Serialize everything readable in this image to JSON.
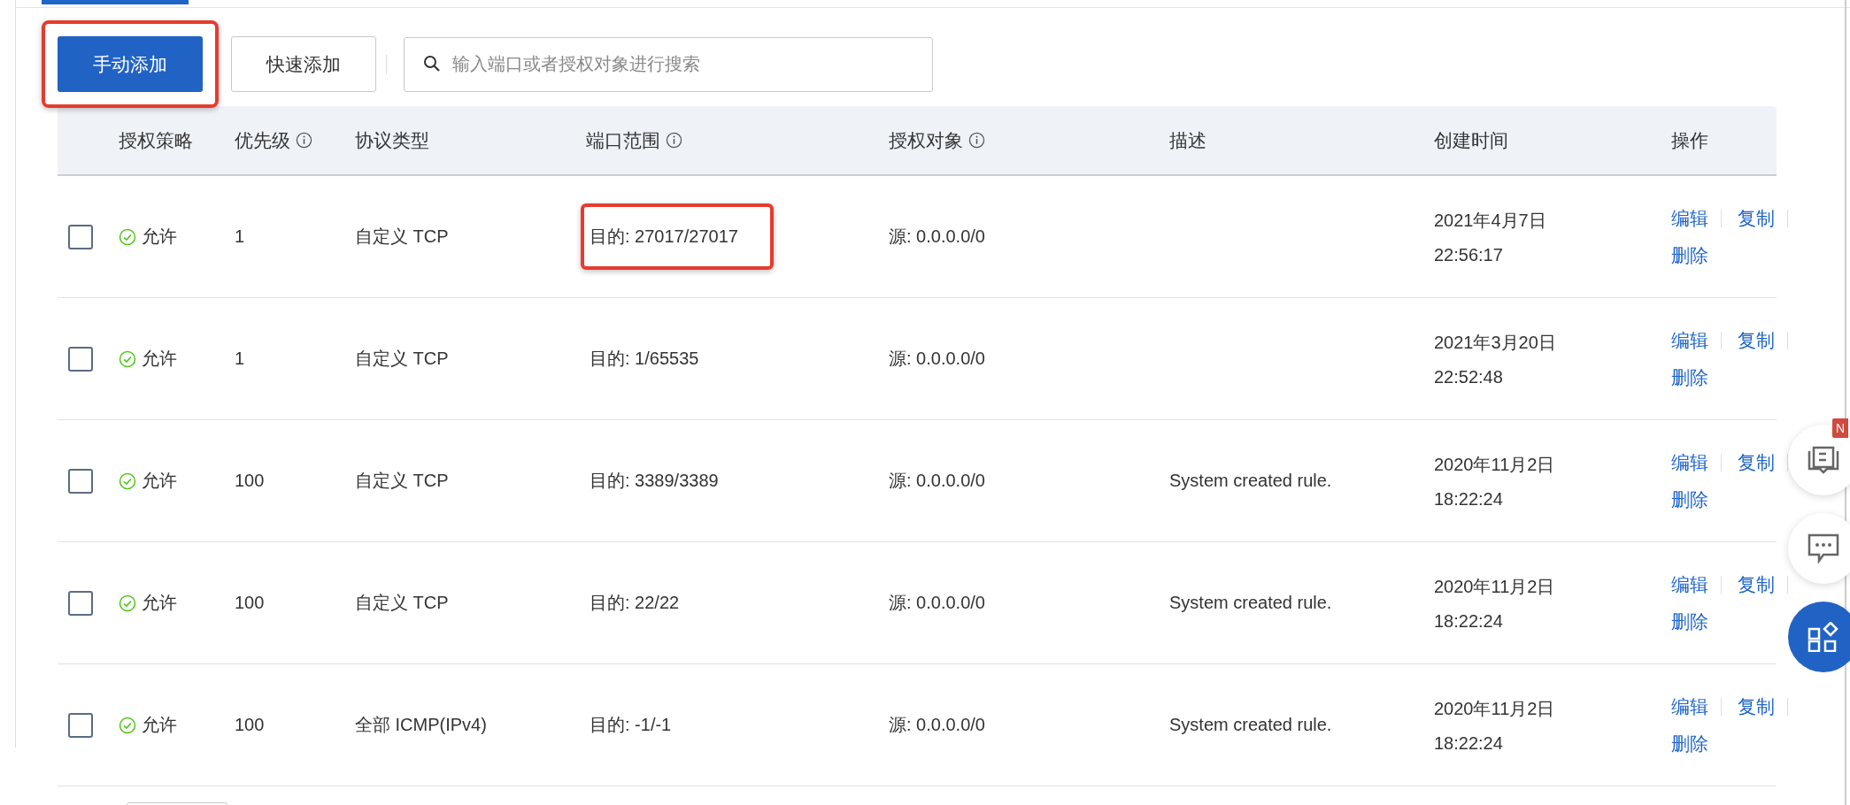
{
  "toolbar": {
    "buttons": [
      {
        "label": "手动添加",
        "kind": "primary",
        "highlighted": true
      },
      {
        "label": "快速添加",
        "kind": "default",
        "highlighted": false
      }
    ],
    "search": {
      "placeholder": "输入端口或者授权对象进行搜索"
    }
  },
  "table": {
    "columns": [
      {
        "label": "授权策略",
        "info": false
      },
      {
        "label": "优先级",
        "info": true
      },
      {
        "label": "协议类型",
        "info": false
      },
      {
        "label": "端口范围",
        "info": true
      },
      {
        "label": "授权对象",
        "info": true
      },
      {
        "label": "描述",
        "info": false
      },
      {
        "label": "创建时间",
        "info": false
      },
      {
        "label": "操作",
        "info": false
      }
    ],
    "rows": [
      {
        "checked": false,
        "policy": "允许",
        "priority": "1",
        "protocol": "自定义 TCP",
        "port": "目的: 27017/27017",
        "port_highlighted": true,
        "source": "源: 0.0.0.0/0",
        "date": "2021年4月7日",
        "time": "22:56:17",
        "actions": [
          "编辑",
          "复制",
          "删除"
        ]
      },
      {
        "checked": false,
        "policy": "允许",
        "priority": "1",
        "protocol": "自定义 TCP",
        "port": "目的: 1/65535",
        "port_highlighted": false,
        "source": "源: 0.0.0.0/0",
        "date": "2021年3月20日",
        "time": "22:52:48",
        "actions": [
          "编辑",
          "复制",
          "删除"
        ]
      },
      {
        "checked": false,
        "policy": "允许",
        "priority": "100",
        "protocol": "自定义 TCP",
        "port": "目的: 3389/3389",
        "port_highlighted": false,
        "source": "源: 0.0.0.0/0",
        "description": "System created rule.",
        "date": "2020年11月2日",
        "time": "18:22:24",
        "actions": [
          "编辑",
          "复制",
          "删除"
        ]
      },
      {
        "checked": false,
        "policy": "允许",
        "priority": "100",
        "protocol": "自定义 TCP",
        "port": "目的: 22/22",
        "port_highlighted": false,
        "source": "源: 0.0.0.0/0",
        "description": "System created rule.",
        "date": "2020年11月2日",
        "time": "18:22:24",
        "actions": [
          "编辑",
          "复制",
          "删除"
        ]
      },
      {
        "checked": false,
        "policy": "允许",
        "priority": "100",
        "protocol": "全部 ICMP(IPv4)",
        "port": "目的: -1/-1",
        "port_highlighted": false,
        "source": "源: 0.0.0.0/0",
        "description": "System created rule.",
        "date": "2020年11月2日",
        "time": "18:22:24",
        "actions": [
          "编辑",
          "复制",
          "删除"
        ]
      }
    ]
  },
  "floating": {
    "badge": "N"
  }
}
